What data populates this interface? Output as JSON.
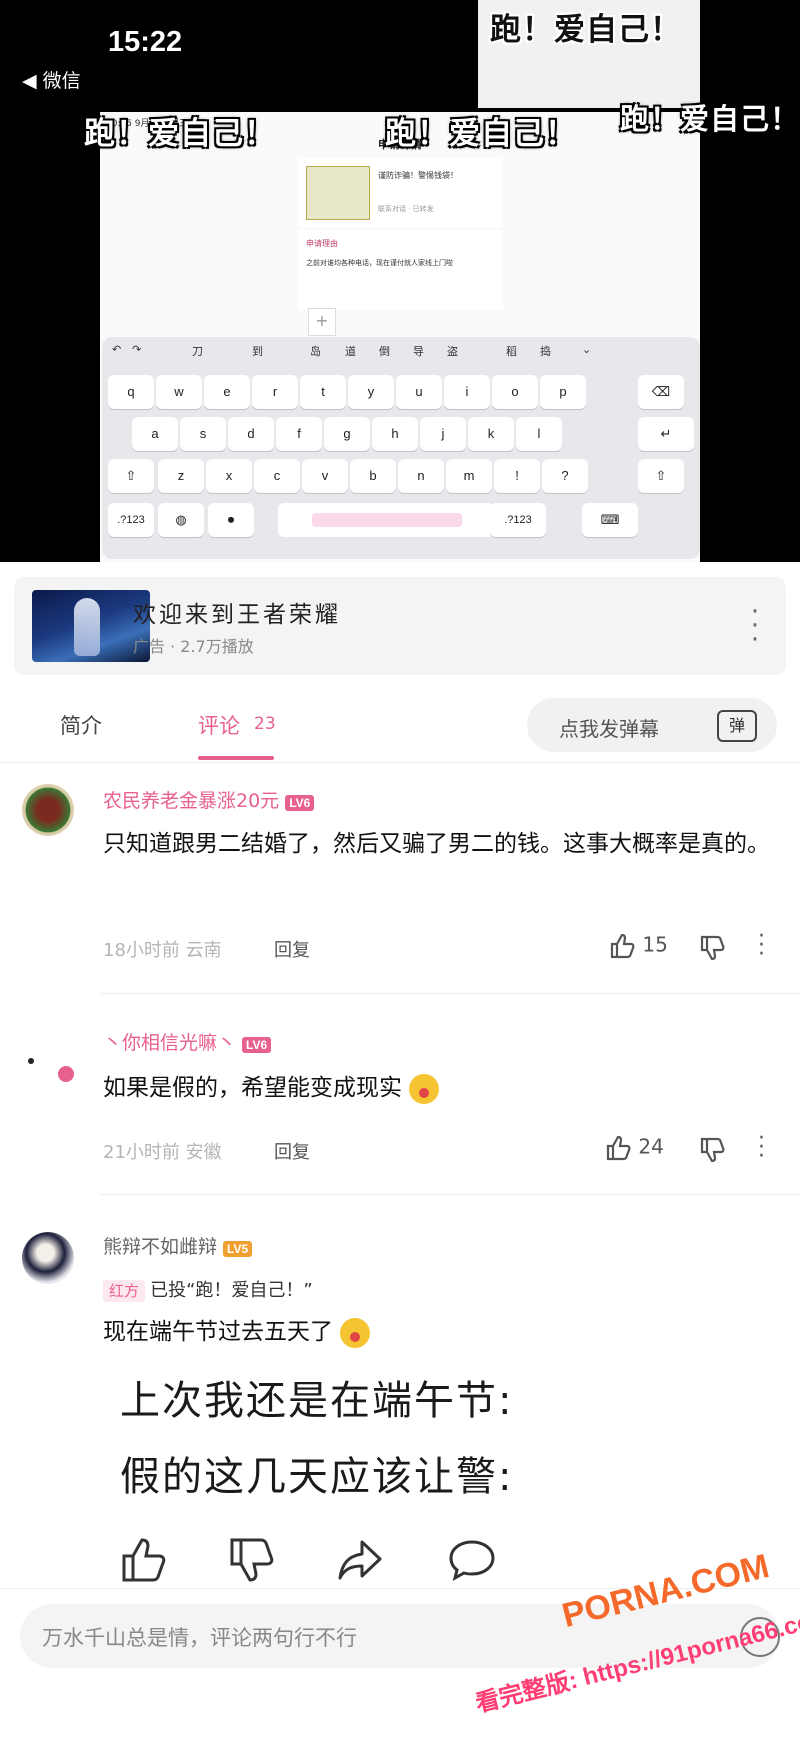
{
  "status": {
    "time": "15:22",
    "back_label": "◀ 微信"
  },
  "video": {
    "danmu": [
      "跑！爱自己！",
      "跑！爱自己！",
      "跑！爱自己！",
      "跑！爱自己！"
    ],
    "phone_status": "20:35  9月24日周三",
    "phone_title": "申请详情",
    "msg1_text": "谨防诈骗！警惕钱袋！",
    "msg1_sub": "联系对话  ·  已转发",
    "msg2_title": "申请理由",
    "msg2_body": "之前对谁均各种电话，现在谨付就人家线上门啦",
    "toolbar": [
      "刀",
      "到",
      "岛",
      "道",
      "倒",
      "导",
      "盗",
      "稻",
      "捣"
    ],
    "keys_row1": [
      "q",
      "w",
      "e",
      "r",
      "t",
      "y",
      "u",
      "i",
      "o",
      "p"
    ],
    "keys_row2": [
      "a",
      "s",
      "d",
      "f",
      "g",
      "h",
      "j",
      "k",
      "l"
    ],
    "keys_row3": [
      "z",
      "x",
      "c",
      "v",
      "b",
      "n",
      "m",
      "!",
      "?"
    ],
    "key_123": ".?123",
    "key_123_right": ".?123"
  },
  "ad": {
    "title": "欢迎来到王者荣耀",
    "meta": "广告 · 2.7万播放"
  },
  "tabs": {
    "intro": "简介",
    "comments": "评论",
    "comments_count": "23",
    "danmu_button": "点我发弹幕",
    "danmu_icon": "弹"
  },
  "comments": [
    {
      "user": "农民养老金暴涨20元",
      "level": "LV6",
      "text": "只知道跟男二结婚了，然后又骗了男二的钱。这事大概率是真的。",
      "time_loc": "18小时前 云南",
      "reply": "回复",
      "likes": "15"
    },
    {
      "user": "丶你相信光嘛丶",
      "level": "LV6",
      "text": "如果是假的，希望能变成现实",
      "time_loc": "21小时前 安徽",
      "reply": "回复",
      "likes": "24"
    },
    {
      "user": "熊辩不如雌辩",
      "level": "LV5",
      "vote_tag": "红方",
      "vote_text": "已投“跑！爱自己！”",
      "text": "现在端午节过去五天了",
      "big1": "上次我还是在端午节:",
      "big2": "假的这几天应该让警:"
    }
  ],
  "bottom": {
    "placeholder": "万水千山总是情，评论两句行不行"
  },
  "watermark": {
    "site": "PORNA.COM",
    "line2": "看完整版: https://91porna66.com"
  }
}
